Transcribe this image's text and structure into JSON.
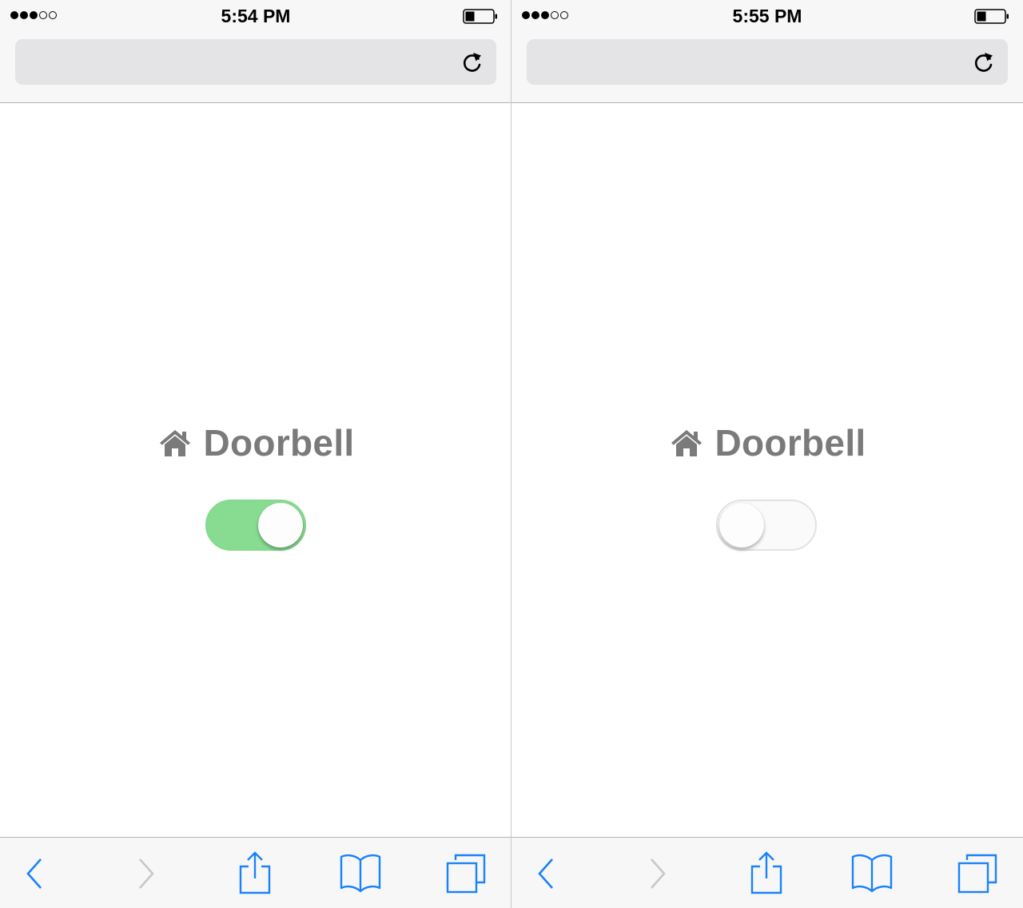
{
  "screens": [
    {
      "status": {
        "time": "5:54 PM",
        "signal_bars": 3,
        "signal_total": 5
      },
      "content": {
        "title": "Doorbell",
        "switch_on": true
      }
    },
    {
      "status": {
        "time": "5:55 PM",
        "signal_bars": 3,
        "signal_total": 5
      },
      "content": {
        "title": "Doorbell",
        "switch_on": false
      }
    }
  ],
  "icons": {
    "title": "house-icon",
    "address_bar": "reload-icon",
    "toolbar": [
      "back-icon",
      "forward-icon",
      "share-icon",
      "bookmarks-icon",
      "tabs-icon"
    ]
  },
  "colors": {
    "accent": "#1a82fb",
    "disabled": "#c7c7cc",
    "switch_on": "#87dc91",
    "switch_off": "#fafafa",
    "title_text": "#7a7a7a"
  }
}
